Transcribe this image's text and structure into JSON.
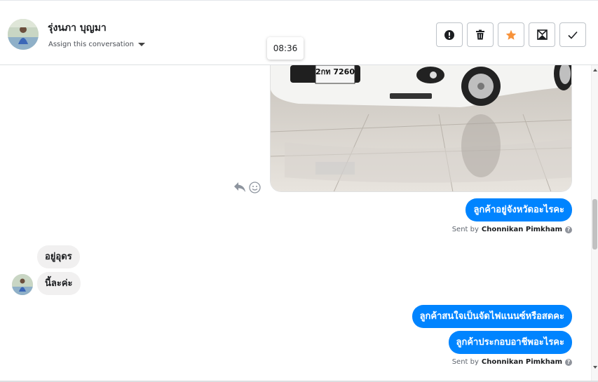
{
  "header": {
    "contact_name": "รุ่งนภา บุญมา",
    "assign_label": "Assign this conversation",
    "timestamp": "08:36"
  },
  "toolbar": {
    "buttons": [
      {
        "name": "mark-spam",
        "icon": "exclamation-circle-icon"
      },
      {
        "name": "delete",
        "icon": "trash-icon"
      },
      {
        "name": "star",
        "icon": "star-icon",
        "color": "#f7923a"
      },
      {
        "name": "mark-unread",
        "icon": "envelope-icon"
      },
      {
        "name": "mark-done",
        "icon": "checkmark-icon"
      }
    ]
  },
  "messages": [
    {
      "from": "page",
      "type": "image",
      "alt": "white car photo"
    },
    {
      "from": "page",
      "text": "ลูกค้าอยู่จังหวัดอะไรคะ"
    },
    {
      "from": "page",
      "type": "sent_by",
      "prefix": "Sent by",
      "who": "Chonnikan Pimkham"
    },
    {
      "from": "customer",
      "text": "อยู่อุดร"
    },
    {
      "from": "customer",
      "text": "นี้ละค่ะ"
    },
    {
      "from": "page",
      "text": "ลูกค้าสนใจเป็นจัดไฟแนนซ์หรือสดคะ"
    },
    {
      "from": "page",
      "text": "ลูกค้าประกอบอาชีพอะไรคะ"
    },
    {
      "from": "page",
      "type": "sent_by",
      "prefix": "Sent by",
      "who": "Chonnikan Pimkham"
    }
  ],
  "plate_text": "2กท 7260",
  "colors": {
    "outgoing_bubble": "#0084ff",
    "incoming_bubble": "#f1f0f0",
    "star": "#f7923a"
  }
}
